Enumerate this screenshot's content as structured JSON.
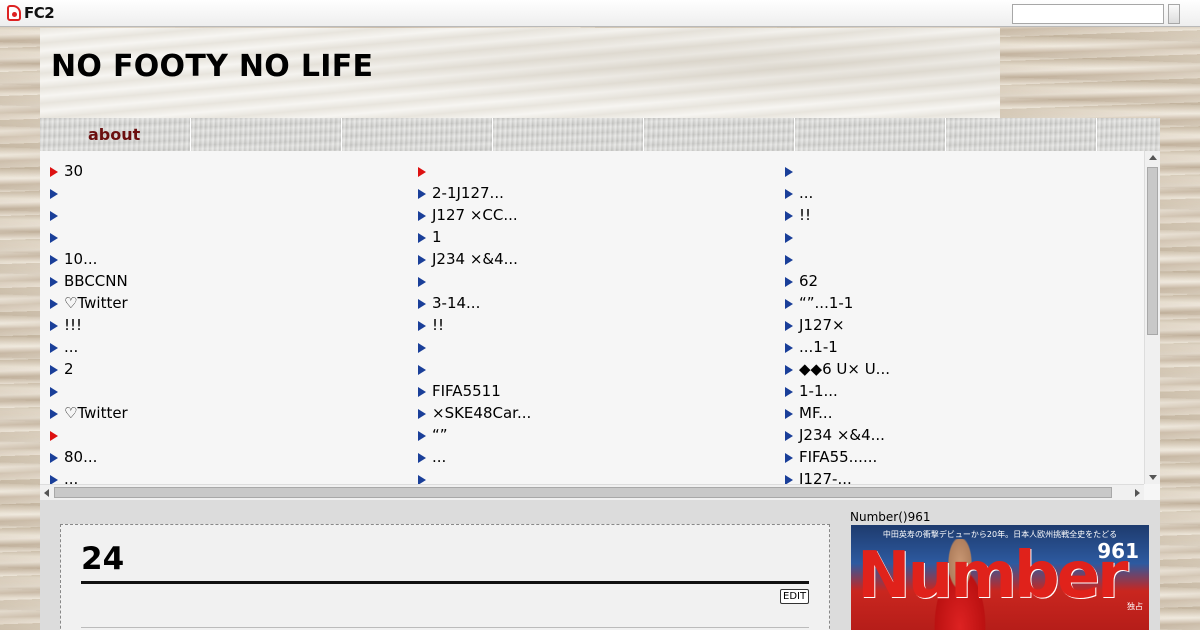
{
  "fc2_bar": {
    "logo_text": "FC2",
    "search_placeholder": ""
  },
  "header": {
    "site_title": "NO FOOTY NO LIFE"
  },
  "nav": {
    "items": [
      "about",
      "",
      "",
      "",
      "",
      "",
      "",
      ""
    ]
  },
  "entry_list": {
    "columns": [
      [
        {
          "text": "30",
          "marker": "red"
        },
        {
          "text": "",
          "marker": "blue"
        },
        {
          "text": "",
          "marker": "blue"
        },
        {
          "text": "",
          "marker": "blue"
        },
        {
          "text": "10...",
          "marker": "blue"
        },
        {
          "text": "BBCCNN",
          "marker": "blue"
        },
        {
          "text": "♡Twitter",
          "marker": "blue"
        },
        {
          "text": "!!!",
          "marker": "blue"
        },
        {
          "text": "...",
          "marker": "blue"
        },
        {
          "text": "2",
          "marker": "blue"
        },
        {
          "text": "",
          "marker": "blue"
        },
        {
          "text": "♡Twitter",
          "marker": "blue"
        },
        {
          "text": "",
          "marker": "red"
        },
        {
          "text": "80...",
          "marker": "blue"
        },
        {
          "text": "...",
          "marker": "blue"
        }
      ],
      [
        {
          "text": "",
          "marker": "red"
        },
        {
          "text": "2-1J127...",
          "marker": "blue"
        },
        {
          "text": "J127 ×CC...",
          "marker": "blue"
        },
        {
          "text": "1",
          "marker": "blue"
        },
        {
          "text": "J234 ×&4...",
          "marker": "blue"
        },
        {
          "text": "",
          "marker": "blue"
        },
        {
          "text": "3-14...",
          "marker": "blue"
        },
        {
          "text": "!!",
          "marker": "blue"
        },
        {
          "text": "",
          "marker": "blue"
        },
        {
          "text": "",
          "marker": "blue"
        },
        {
          "text": "FIFA5511",
          "marker": "blue"
        },
        {
          "text": "×SKE48Car...",
          "marker": "blue"
        },
        {
          "text": "“”",
          "marker": "blue"
        },
        {
          "text": "...",
          "marker": "blue"
        },
        {
          "text": "",
          "marker": "blue"
        }
      ],
      [
        {
          "text": "",
          "marker": "blue"
        },
        {
          "text": "...",
          "marker": "blue"
        },
        {
          "text": "!!",
          "marker": "blue"
        },
        {
          "text": "",
          "marker": "blue"
        },
        {
          "text": "",
          "marker": "blue"
        },
        {
          "text": "62",
          "marker": "blue"
        },
        {
          "text": "“”...1-1",
          "marker": "blue"
        },
        {
          "text": "J127×",
          "marker": "blue"
        },
        {
          "text": "...1-1",
          "marker": "blue"
        },
        {
          "text": "◆◆6 U× U...",
          "marker": "blue"
        },
        {
          "text": "1-1...",
          "marker": "blue"
        },
        {
          "text": "MF...",
          "marker": "blue"
        },
        {
          "text": "J234 ×&4...",
          "marker": "blue"
        },
        {
          "text": "FIFA55......",
          "marker": "blue"
        },
        {
          "text": "J127-...",
          "marker": "blue"
        }
      ]
    ]
  },
  "entry": {
    "title": "24",
    "edit_label": "EDIT"
  },
  "sidebar": {
    "title": "Number()961",
    "magazine": {
      "top_line": "中田英寿の衝撃デビューから20年。日本人欧州挑戦全史をたどる",
      "logo": "Number",
      "issue": "961",
      "sub": "独占"
    }
  },
  "colors": {
    "nav_label": "#6b0f0f",
    "marker_blue": "#1a3f99",
    "marker_red": "#d11"
  }
}
